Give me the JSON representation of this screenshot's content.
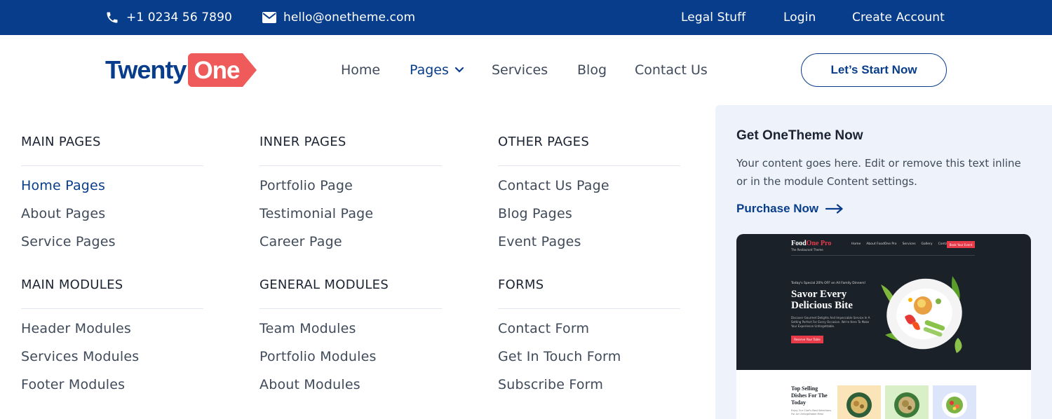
{
  "topbar": {
    "phone": "+1 0234 56 7890",
    "email": "hello@onetheme.com",
    "links": [
      "Legal Stuff",
      "Login",
      "Create Account"
    ]
  },
  "logo": {
    "part1": "Twenty",
    "part2": "One"
  },
  "nav": {
    "items": [
      "Home",
      "Pages",
      "Services",
      "Blog",
      "Contact Us"
    ],
    "active": "Pages"
  },
  "cta": {
    "label": "Let’s Start Now"
  },
  "menu": {
    "columns": [
      {
        "groups": [
          {
            "heading": "MAIN PAGES",
            "items": [
              "Home Pages",
              "About Pages",
              "Service Pages"
            ]
          },
          {
            "heading": "MAIN MODULES",
            "items": [
              "Header Modules",
              "Services Modules",
              "Footer Modules"
            ]
          }
        ]
      },
      {
        "groups": [
          {
            "heading": "INNER PAGES",
            "items": [
              "Portfolio Page",
              "Testimonial Page",
              "Career Page"
            ]
          },
          {
            "heading": "GENERAL MODULES",
            "items": [
              "Team Modules",
              "Portfolio Modules",
              "About Modules"
            ]
          }
        ]
      },
      {
        "groups": [
          {
            "heading": "OTHER PAGES",
            "items": [
              "Contact Us Page",
              "Blog Pages",
              "Event Pages"
            ]
          },
          {
            "heading": "FORMS",
            "items": [
              "Contact Form",
              "Get In Touch Form",
              "Subscribe Form"
            ]
          }
        ]
      }
    ],
    "active_item": "Home Pages"
  },
  "promo": {
    "title": "Get OneTheme Now",
    "text": "Your content goes here. Edit or remove this text inline or in the module Content settings.",
    "link": "Purchase Now",
    "preview": {
      "logo_a": "Food",
      "logo_b": "One Pro",
      "tagline": "The Restaurant Theme",
      "nav": [
        "Home",
        "About FoodOne Pro",
        "Services",
        "Gallery",
        "Contact"
      ],
      "button": "Book Your Event",
      "special": "Today's Special 20% OFF on All Family Dinners!",
      "headline_1": "Savor Every",
      "headline_2": "Delicious Bite",
      "description": "Discover Gourmet Delights And Impeccable Service In A Setting Perfect For Every Occasion. We're Here To Make Your Experience Unforgettable.",
      "reserve": "Reserve Your Table",
      "section_1": "Top Selling",
      "section_2": "Dishes For The",
      "section_3": "Today",
      "section_sub": "Enjoy Our Chef's Best Selections For An Unforgettable Meal"
    }
  },
  "colors": {
    "brand_blue": "#083d8b",
    "brand_coral": "#ef5b5b",
    "promo_bg": "#eef3fb"
  }
}
